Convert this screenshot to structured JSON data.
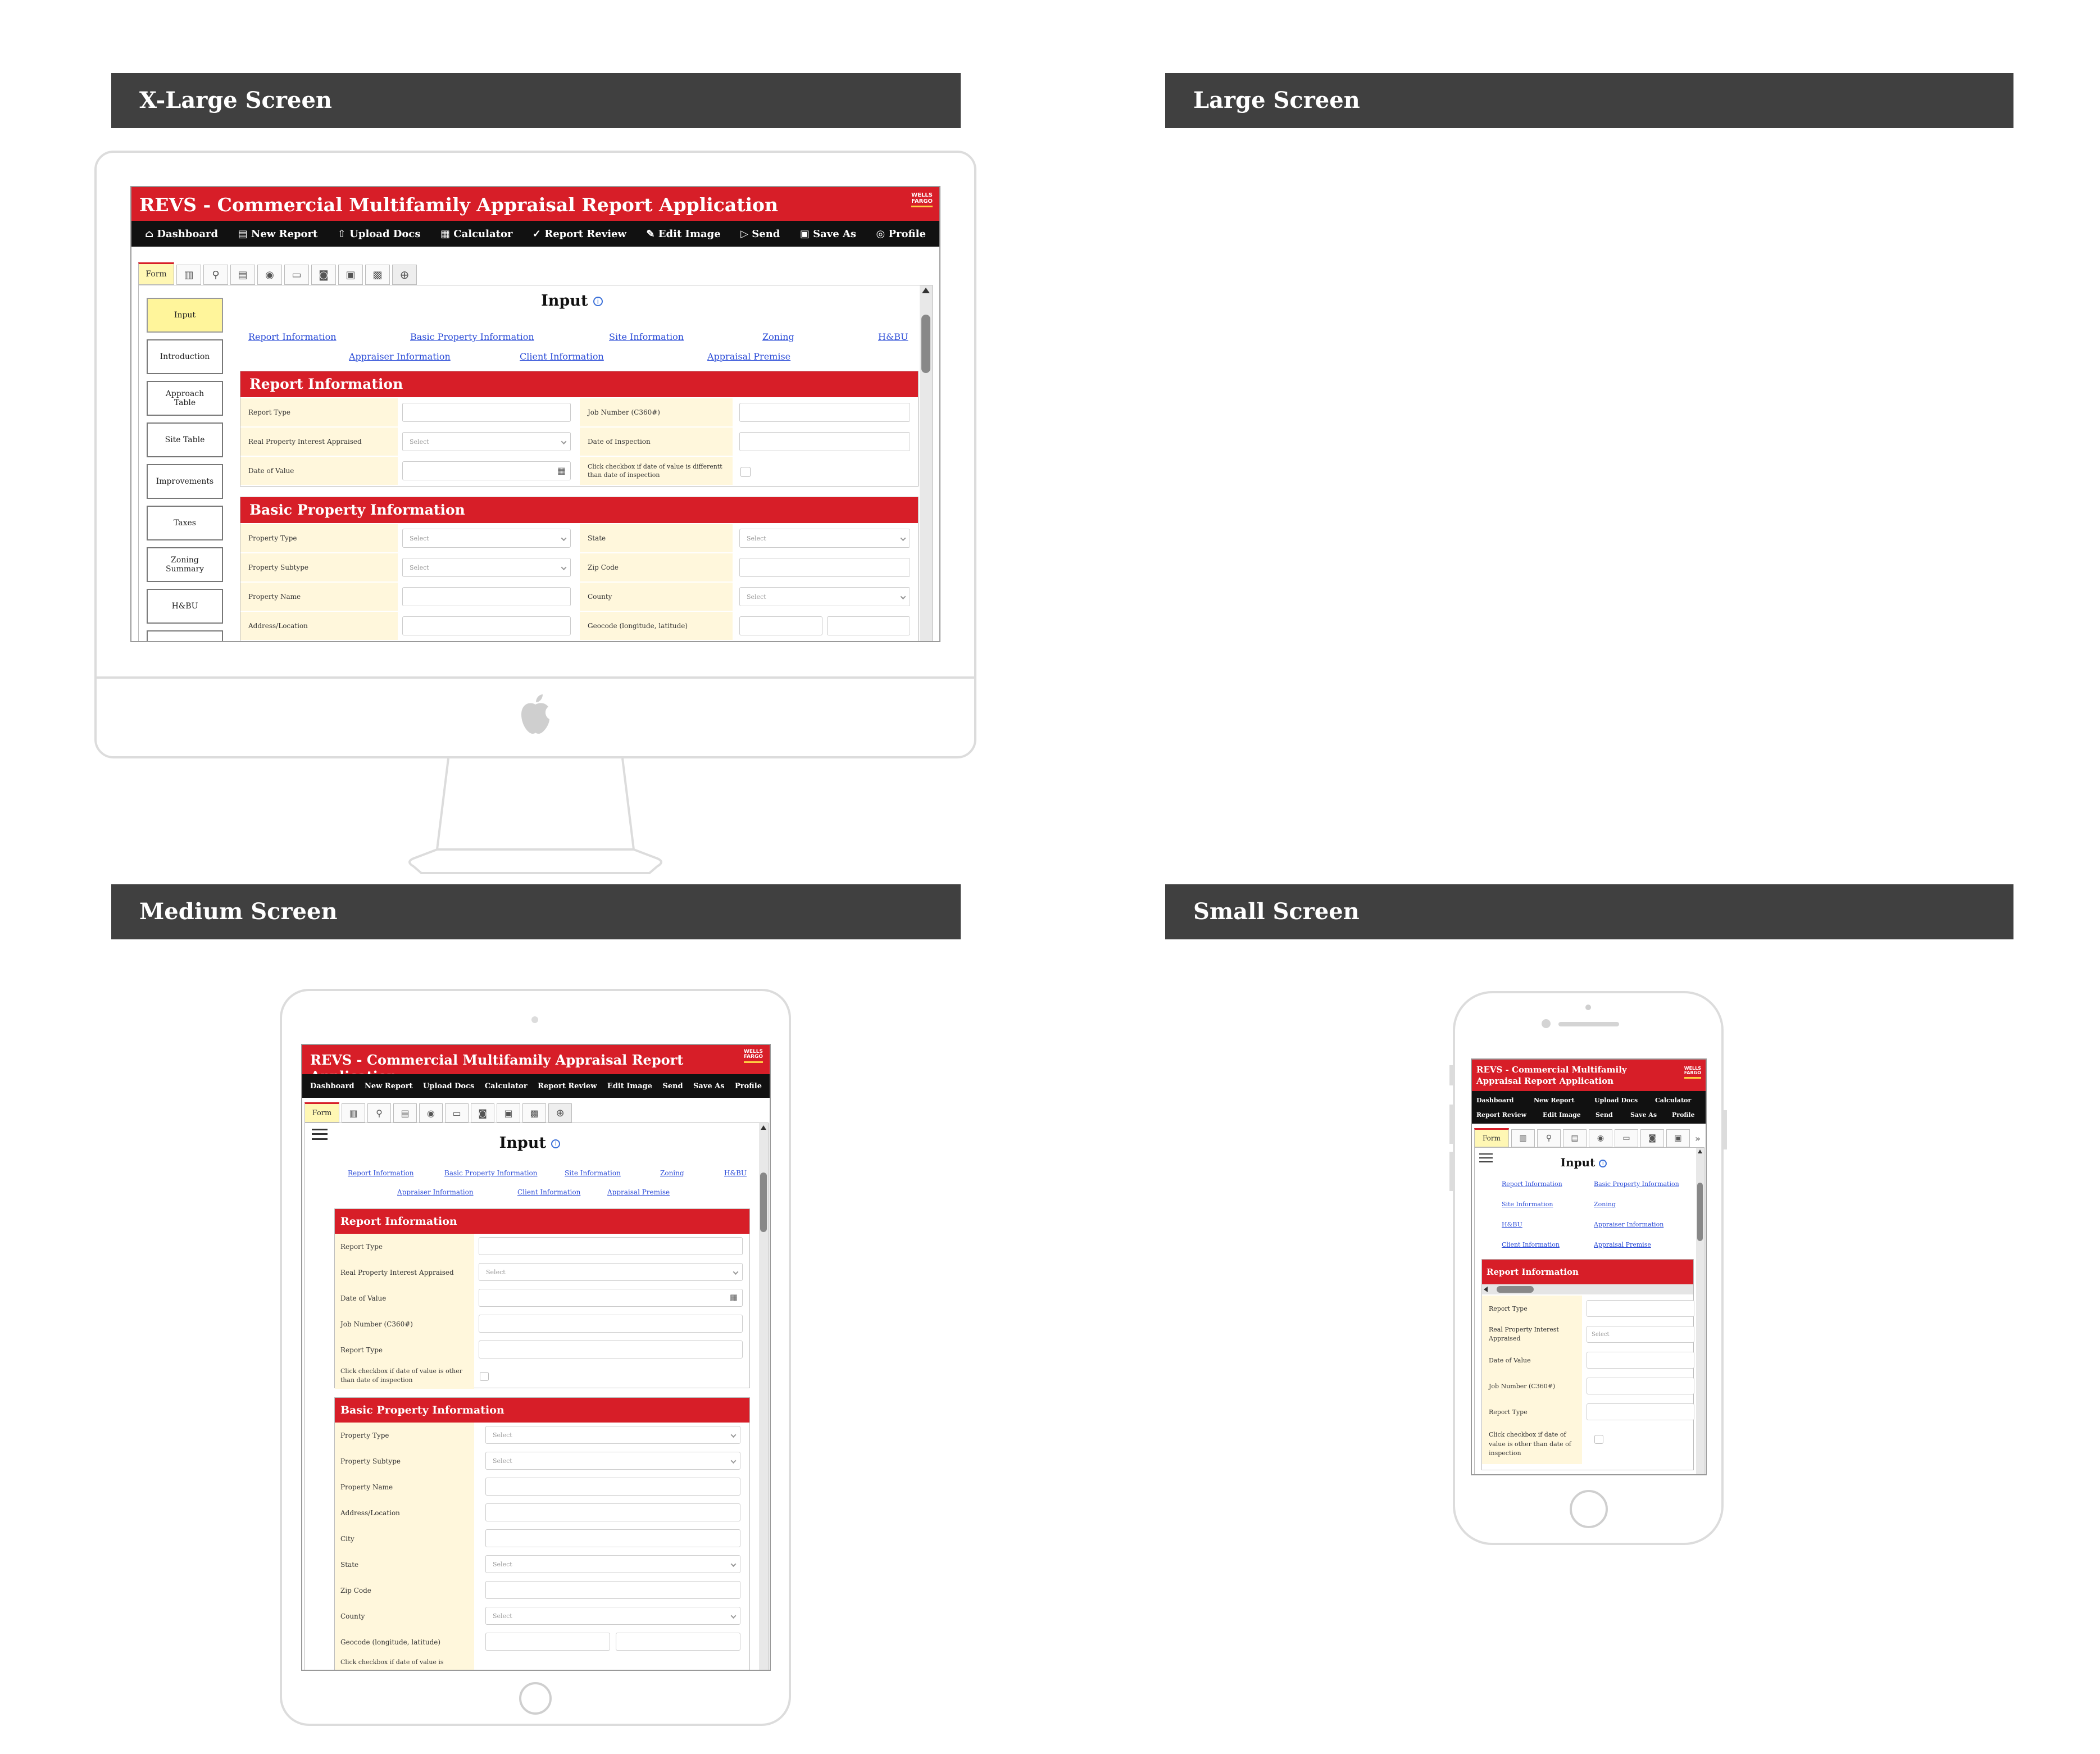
{
  "labels": {
    "xl": "X-Large Screen",
    "lg": "Large Screen",
    "md": "Medium Screen",
    "sm": "Small Screen"
  },
  "app": {
    "title": "REVS - Commercial Multifamily Appraisal Report Application",
    "brand_line1": "WELLS",
    "brand_line2": "FARGO",
    "nav": {
      "dashboard": "Dashboard",
      "new_report": "New Report",
      "upload_docs": "Upload Docs",
      "calculator": "Calculator",
      "report_review": "Report Review",
      "edit_image": "Edit Image",
      "send": "Send",
      "save_as": "Save As",
      "profile": "Profile"
    },
    "nav_icons": {
      "dashboard": "⌂",
      "new_report": "▤",
      "upload_docs": "⇧",
      "calculator": "▦",
      "report_review": "✓",
      "edit_image": "✎",
      "send": "▷",
      "save_as": "▣",
      "profile": "◎"
    },
    "form_tab": "Form",
    "tab_icons": [
      "building-icon",
      "pin-icon",
      "document-icon",
      "eye-icon",
      "card-icon",
      "camera-icon",
      "image-icon",
      "photo-icon",
      "plus-icon"
    ],
    "heading": "Input",
    "info_glyph": "i",
    "links": {
      "report_information": "Report Information",
      "basic_property_information": "Basic Property Information",
      "site_information": "Site Information",
      "zoning": "Zoning",
      "hbu": "H&BU",
      "appraiser_information": "Appraiser Information",
      "client_information": "Client Information",
      "appraisal_premise": "Appraisal Premise"
    },
    "sidebar": {
      "input": "Input",
      "introduction": "Introduction",
      "approach_table": "Approach Table",
      "site_table": "Site Table",
      "improvements": "Improvements",
      "taxes": "Taxes",
      "zoning_summary": "Zoning Summary",
      "hbu": "H&BU"
    },
    "report_section": "Report Information",
    "basic_section": "Basic Property Information",
    "fields": {
      "report_type": "Report Type",
      "real_property_interest": "Real Property Interest Appraised",
      "date_of_value": "Date of Value",
      "job_number": "Job Number (C360#)",
      "date_of_inspection": "Date of Inspection",
      "checkbox_xl": "Click checkbox if date of value is differentt than date of inspection",
      "checkbox_md": "Click checkbox if date of value is other than date of inspection",
      "checkbox_md_cut": "Click checkbox if date of value is",
      "property_type": "Property Type",
      "property_subtype": "Property Subtype",
      "property_name": "Property Name",
      "address": "Address/Location",
      "city": "City",
      "state": "State",
      "zip": "Zip Code",
      "county": "County",
      "geocode": "Geocode (longitude, latitude)"
    },
    "select_placeholder": "Select"
  }
}
